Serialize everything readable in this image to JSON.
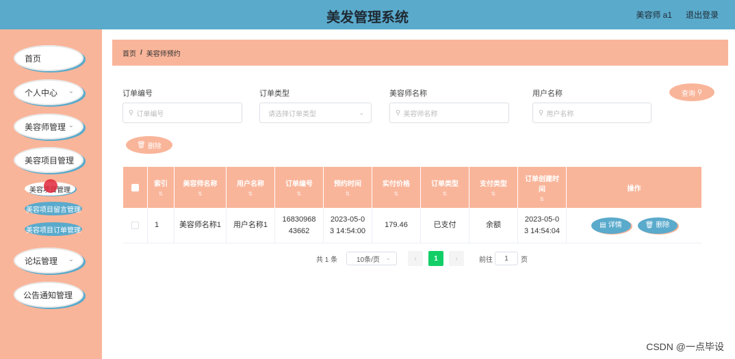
{
  "header": {
    "title": "美发管理系统",
    "user": "美容师 a1",
    "logout": "退出登录"
  },
  "sidebar": {
    "items": [
      {
        "label": "首页"
      },
      {
        "label": "个人中心"
      },
      {
        "label": "美容师管理"
      },
      {
        "label": "美容项目管理"
      },
      {
        "label": "论坛管理"
      },
      {
        "label": "公告通知管理"
      }
    ],
    "subitems": [
      {
        "label": "美容项目管理"
      },
      {
        "label": "美容项目留言管理"
      },
      {
        "label": "美容项目订单管理"
      }
    ]
  },
  "breadcrumb": {
    "home": "首页",
    "sep": "/",
    "current": "美容师预约"
  },
  "filters": {
    "order_no": {
      "label": "订单编号",
      "placeholder": "订单编号"
    },
    "order_type": {
      "label": "订单类型",
      "placeholder": "请选择订单类型"
    },
    "beautician_name": {
      "label": "美容师名称",
      "placeholder": "美容师名称"
    },
    "user_name": {
      "label": "用户名称",
      "placeholder": "用户名称"
    }
  },
  "buttons": {
    "search": "查询",
    "delete": "删除"
  },
  "table": {
    "columns": [
      "索引",
      "美容师名称",
      "用户名称",
      "订单编号",
      "预约时间",
      "实付价格",
      "订单类型",
      "支付类型",
      "订单创建时间",
      "操作"
    ],
    "rows": [
      {
        "index": "1",
        "beautician_name": "美容师名称1",
        "user_name": "用户名称1",
        "order_no_l1": "16830968",
        "order_no_l2": "43662",
        "appt_l1": "2023-05-0",
        "appt_l2": "3 14:54:00",
        "price": "179.46",
        "order_type": "已支付",
        "pay_type": "余额",
        "created_l1": "2023-05-0",
        "created_l2": "3 14:54:04",
        "detail": "详情",
        "delete": "删除"
      }
    ]
  },
  "pagination": {
    "total": "共 1 条",
    "page_size": "10条/页",
    "current": "1",
    "goto_prefix": "前往",
    "goto_value": "1",
    "goto_suffix": "页"
  },
  "watermark": "CSDN @一点毕设",
  "colors": {
    "header_blue": "#5aaacc",
    "salmon": "#f9b59a",
    "active_page": "#13ce66"
  }
}
